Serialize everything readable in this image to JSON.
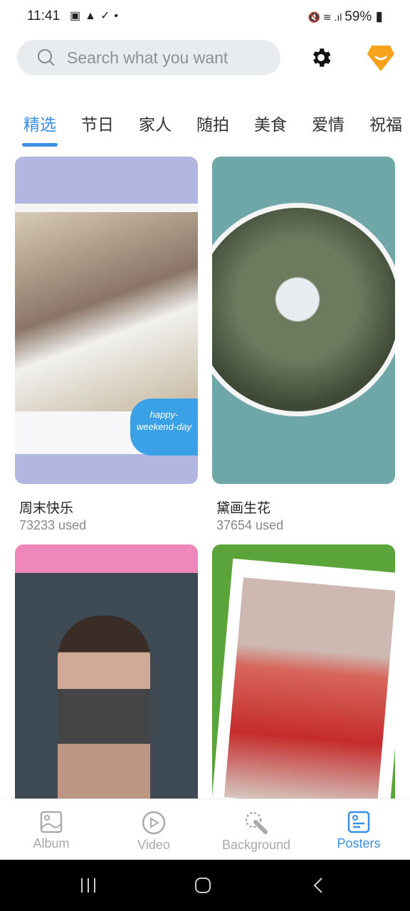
{
  "status": {
    "time": "11:41",
    "battery": "59%"
  },
  "search": {
    "placeholder": "Search what you want"
  },
  "tabs": [
    "精选",
    "节日",
    "家人",
    "随拍",
    "美食",
    "爱情",
    "祝福"
  ],
  "cards": [
    {
      "title": "周末快乐",
      "used": "73233 used",
      "overlay_text": "happy-weekend-day"
    },
    {
      "title": "黛画生花",
      "used": "37654 used"
    },
    {},
    {}
  ],
  "bottom_nav": [
    {
      "label": "Album"
    },
    {
      "label": "Video"
    },
    {
      "label": "Background"
    },
    {
      "label": "Posters",
      "active": true
    }
  ],
  "colors": {
    "accent": "#3a8ee6",
    "vip": "#f7a21b"
  }
}
